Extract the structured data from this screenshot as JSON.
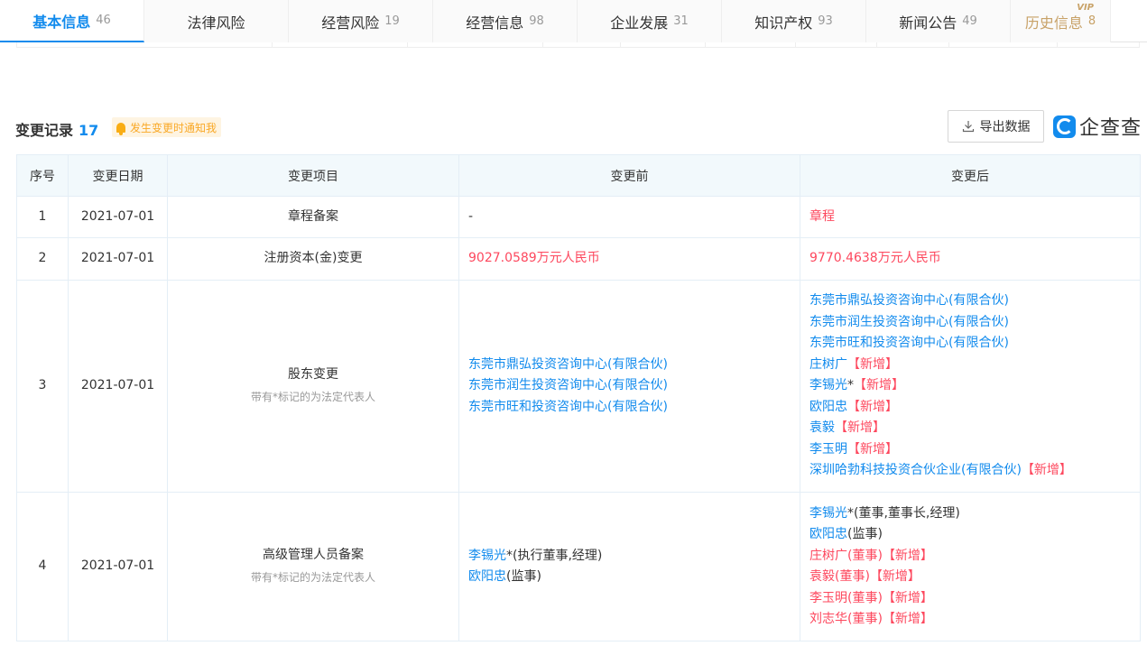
{
  "tabs": [
    {
      "label": "基本信息",
      "count": "46"
    },
    {
      "label": "法律风险",
      "count": ""
    },
    {
      "label": "经营风险",
      "count": "19"
    },
    {
      "label": "经营信息",
      "count": "98"
    },
    {
      "label": "企业发展",
      "count": "31"
    },
    {
      "label": "知识产权",
      "count": "93"
    },
    {
      "label": "新闻公告",
      "count": "49"
    },
    {
      "label": "历史信息",
      "count": "8",
      "badge": "VIP"
    }
  ],
  "section": {
    "title": "变更记录",
    "count": "17",
    "notify_label": "发生变更时通知我",
    "export_label": "导出数据",
    "logo_text": "企查查"
  },
  "table": {
    "headers": [
      "序号",
      "变更日期",
      "变更项目",
      "变更前",
      "变更后"
    ],
    "legal_rep_note": "带有*标记的为法定代表人",
    "new_tag": "【新增】",
    "rows": [
      {
        "index": "1",
        "date": "2021-07-01",
        "item": "章程备案",
        "note": "",
        "before": [
          {
            "text": "-",
            "style": "plain"
          }
        ],
        "after": [
          {
            "text": "章程",
            "style": "red"
          }
        ]
      },
      {
        "index": "2",
        "date": "2021-07-01",
        "item": "注册资本(金)变更",
        "note": "",
        "before": [
          {
            "text": "9027.0589万元人民币",
            "style": "red"
          }
        ],
        "after": [
          {
            "text": "9770.4638万元人民币",
            "style": "red"
          }
        ]
      },
      {
        "index": "3",
        "date": "2021-07-01",
        "item": "股东变更",
        "note": "带有*标记的为法定代表人",
        "before": [
          {
            "name": "东莞市鼎弘投资咨询中心(有限合伙)"
          },
          {
            "name": "东莞市润生投资咨询中心(有限合伙)"
          },
          {
            "name": "东莞市旺和投资咨询中心(有限合伙)"
          }
        ],
        "after": [
          {
            "name": "东莞市鼎弘投资咨询中心(有限合伙)"
          },
          {
            "name": "东莞市润生投资咨询中心(有限合伙)"
          },
          {
            "name": "东莞市旺和投资咨询中心(有限合伙)"
          },
          {
            "name": "庄树广",
            "new": true
          },
          {
            "name": "李锡光",
            "star": true,
            "new": true
          },
          {
            "name": "欧阳忠",
            "new": true
          },
          {
            "name": "袁毅",
            "new": true
          },
          {
            "name": "李玉明",
            "new": true
          },
          {
            "name": "深圳哈勃科技投资合伙企业(有限合伙)",
            "new": true
          }
        ]
      },
      {
        "index": "4",
        "date": "2021-07-01",
        "item": "高级管理人员备案",
        "note": "带有*标记的为法定代表人",
        "before": [
          {
            "name": "李锡光",
            "star": true,
            "role": "(执行董事,经理)"
          },
          {
            "name": "欧阳忠",
            "role": "(监事)"
          }
        ],
        "after": [
          {
            "name": "李锡光",
            "star": true,
            "role": "(董事,董事长,经理)"
          },
          {
            "name": "欧阳忠",
            "role": "(监事)"
          },
          {
            "name": "庄树广",
            "role": "(董事)",
            "new": true,
            "red": true
          },
          {
            "name": "袁毅",
            "role": "(董事)",
            "new": true,
            "red": true
          },
          {
            "name": "李玉明",
            "role": "(董事)",
            "new": true,
            "red": true
          },
          {
            "name": "刘志华",
            "role": "(董事)",
            "new": true,
            "red": true
          }
        ]
      }
    ]
  }
}
